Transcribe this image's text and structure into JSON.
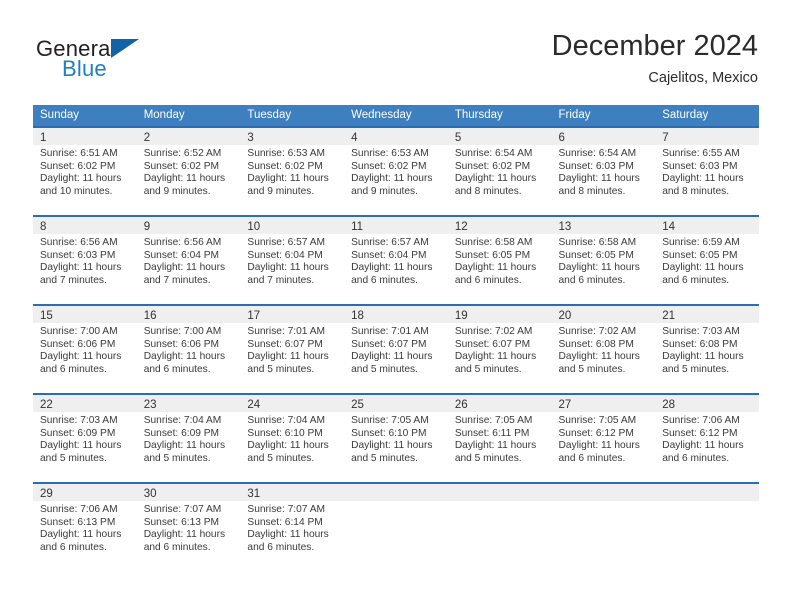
{
  "brand": {
    "name_part1": "General",
    "name_part2": "Blue",
    "triangle_icon": "brand-triangle-icon",
    "colors": {
      "dark": "#231f20",
      "blue": "#1f7fc4",
      "triangle": "#1262a8"
    }
  },
  "header": {
    "title": "December 2024",
    "location": "Cajelitos, Mexico"
  },
  "theme": {
    "header_row_bg": "#3d7fbf",
    "cell_top_border": "#2a6db5",
    "daynum_band_bg": "#efefef",
    "text": "#3a3a3a"
  },
  "calendar": {
    "weekdays": [
      "Sunday",
      "Monday",
      "Tuesday",
      "Wednesday",
      "Thursday",
      "Friday",
      "Saturday"
    ],
    "weeks": [
      [
        {
          "day": "1",
          "sunrise": "Sunrise: 6:51 AM",
          "sunset": "Sunset: 6:02 PM",
          "daylight1": "Daylight: 11 hours",
          "daylight2": "and 10 minutes."
        },
        {
          "day": "2",
          "sunrise": "Sunrise: 6:52 AM",
          "sunset": "Sunset: 6:02 PM",
          "daylight1": "Daylight: 11 hours",
          "daylight2": "and 9 minutes."
        },
        {
          "day": "3",
          "sunrise": "Sunrise: 6:53 AM",
          "sunset": "Sunset: 6:02 PM",
          "daylight1": "Daylight: 11 hours",
          "daylight2": "and 9 minutes."
        },
        {
          "day": "4",
          "sunrise": "Sunrise: 6:53 AM",
          "sunset": "Sunset: 6:02 PM",
          "daylight1": "Daylight: 11 hours",
          "daylight2": "and 9 minutes."
        },
        {
          "day": "5",
          "sunrise": "Sunrise: 6:54 AM",
          "sunset": "Sunset: 6:02 PM",
          "daylight1": "Daylight: 11 hours",
          "daylight2": "and 8 minutes."
        },
        {
          "day": "6",
          "sunrise": "Sunrise: 6:54 AM",
          "sunset": "Sunset: 6:03 PM",
          "daylight1": "Daylight: 11 hours",
          "daylight2": "and 8 minutes."
        },
        {
          "day": "7",
          "sunrise": "Sunrise: 6:55 AM",
          "sunset": "Sunset: 6:03 PM",
          "daylight1": "Daylight: 11 hours",
          "daylight2": "and 8 minutes."
        }
      ],
      [
        {
          "day": "8",
          "sunrise": "Sunrise: 6:56 AM",
          "sunset": "Sunset: 6:03 PM",
          "daylight1": "Daylight: 11 hours",
          "daylight2": "and 7 minutes."
        },
        {
          "day": "9",
          "sunrise": "Sunrise: 6:56 AM",
          "sunset": "Sunset: 6:04 PM",
          "daylight1": "Daylight: 11 hours",
          "daylight2": "and 7 minutes."
        },
        {
          "day": "10",
          "sunrise": "Sunrise: 6:57 AM",
          "sunset": "Sunset: 6:04 PM",
          "daylight1": "Daylight: 11 hours",
          "daylight2": "and 7 minutes."
        },
        {
          "day": "11",
          "sunrise": "Sunrise: 6:57 AM",
          "sunset": "Sunset: 6:04 PM",
          "daylight1": "Daylight: 11 hours",
          "daylight2": "and 6 minutes."
        },
        {
          "day": "12",
          "sunrise": "Sunrise: 6:58 AM",
          "sunset": "Sunset: 6:05 PM",
          "daylight1": "Daylight: 11 hours",
          "daylight2": "and 6 minutes."
        },
        {
          "day": "13",
          "sunrise": "Sunrise: 6:58 AM",
          "sunset": "Sunset: 6:05 PM",
          "daylight1": "Daylight: 11 hours",
          "daylight2": "and 6 minutes."
        },
        {
          "day": "14",
          "sunrise": "Sunrise: 6:59 AM",
          "sunset": "Sunset: 6:05 PM",
          "daylight1": "Daylight: 11 hours",
          "daylight2": "and 6 minutes."
        }
      ],
      [
        {
          "day": "15",
          "sunrise": "Sunrise: 7:00 AM",
          "sunset": "Sunset: 6:06 PM",
          "daylight1": "Daylight: 11 hours",
          "daylight2": "and 6 minutes."
        },
        {
          "day": "16",
          "sunrise": "Sunrise: 7:00 AM",
          "sunset": "Sunset: 6:06 PM",
          "daylight1": "Daylight: 11 hours",
          "daylight2": "and 6 minutes."
        },
        {
          "day": "17",
          "sunrise": "Sunrise: 7:01 AM",
          "sunset": "Sunset: 6:07 PM",
          "daylight1": "Daylight: 11 hours",
          "daylight2": "and 5 minutes."
        },
        {
          "day": "18",
          "sunrise": "Sunrise: 7:01 AM",
          "sunset": "Sunset: 6:07 PM",
          "daylight1": "Daylight: 11 hours",
          "daylight2": "and 5 minutes."
        },
        {
          "day": "19",
          "sunrise": "Sunrise: 7:02 AM",
          "sunset": "Sunset: 6:07 PM",
          "daylight1": "Daylight: 11 hours",
          "daylight2": "and 5 minutes."
        },
        {
          "day": "20",
          "sunrise": "Sunrise: 7:02 AM",
          "sunset": "Sunset: 6:08 PM",
          "daylight1": "Daylight: 11 hours",
          "daylight2": "and 5 minutes."
        },
        {
          "day": "21",
          "sunrise": "Sunrise: 7:03 AM",
          "sunset": "Sunset: 6:08 PM",
          "daylight1": "Daylight: 11 hours",
          "daylight2": "and 5 minutes."
        }
      ],
      [
        {
          "day": "22",
          "sunrise": "Sunrise: 7:03 AM",
          "sunset": "Sunset: 6:09 PM",
          "daylight1": "Daylight: 11 hours",
          "daylight2": "and 5 minutes."
        },
        {
          "day": "23",
          "sunrise": "Sunrise: 7:04 AM",
          "sunset": "Sunset: 6:09 PM",
          "daylight1": "Daylight: 11 hours",
          "daylight2": "and 5 minutes."
        },
        {
          "day": "24",
          "sunrise": "Sunrise: 7:04 AM",
          "sunset": "Sunset: 6:10 PM",
          "daylight1": "Daylight: 11 hours",
          "daylight2": "and 5 minutes."
        },
        {
          "day": "25",
          "sunrise": "Sunrise: 7:05 AM",
          "sunset": "Sunset: 6:10 PM",
          "daylight1": "Daylight: 11 hours",
          "daylight2": "and 5 minutes."
        },
        {
          "day": "26",
          "sunrise": "Sunrise: 7:05 AM",
          "sunset": "Sunset: 6:11 PM",
          "daylight1": "Daylight: 11 hours",
          "daylight2": "and 5 minutes."
        },
        {
          "day": "27",
          "sunrise": "Sunrise: 7:05 AM",
          "sunset": "Sunset: 6:12 PM",
          "daylight1": "Daylight: 11 hours",
          "daylight2": "and 6 minutes."
        },
        {
          "day": "28",
          "sunrise": "Sunrise: 7:06 AM",
          "sunset": "Sunset: 6:12 PM",
          "daylight1": "Daylight: 11 hours",
          "daylight2": "and 6 minutes."
        }
      ],
      [
        {
          "day": "29",
          "sunrise": "Sunrise: 7:06 AM",
          "sunset": "Sunset: 6:13 PM",
          "daylight1": "Daylight: 11 hours",
          "daylight2": "and 6 minutes."
        },
        {
          "day": "30",
          "sunrise": "Sunrise: 7:07 AM",
          "sunset": "Sunset: 6:13 PM",
          "daylight1": "Daylight: 11 hours",
          "daylight2": "and 6 minutes."
        },
        {
          "day": "31",
          "sunrise": "Sunrise: 7:07 AM",
          "sunset": "Sunset: 6:14 PM",
          "daylight1": "Daylight: 11 hours",
          "daylight2": "and 6 minutes."
        },
        {
          "day": "",
          "sunrise": "",
          "sunset": "",
          "daylight1": "",
          "daylight2": ""
        },
        {
          "day": "",
          "sunrise": "",
          "sunset": "",
          "daylight1": "",
          "daylight2": ""
        },
        {
          "day": "",
          "sunrise": "",
          "sunset": "",
          "daylight1": "",
          "daylight2": ""
        },
        {
          "day": "",
          "sunrise": "",
          "sunset": "",
          "daylight1": "",
          "daylight2": ""
        }
      ]
    ]
  }
}
